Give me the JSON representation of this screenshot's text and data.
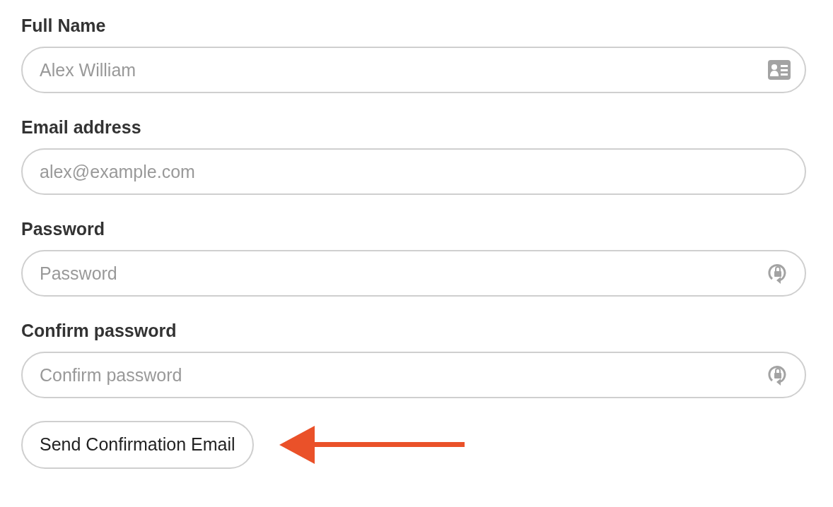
{
  "fields": [
    {
      "label": "Full Name",
      "placeholder": "Alex William",
      "kind": "name"
    },
    {
      "label": "Email address",
      "placeholder": "alex@example.com",
      "kind": "email"
    },
    {
      "label": "Password",
      "placeholder": "Password",
      "kind": "password"
    },
    {
      "label": "Confirm password",
      "placeholder": "Confirm password",
      "kind": "password"
    }
  ],
  "button": "Send Confirmation Email"
}
